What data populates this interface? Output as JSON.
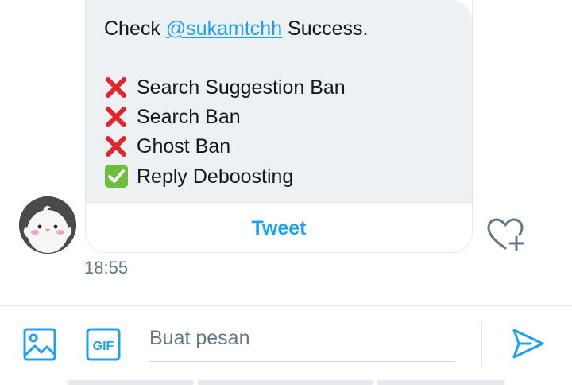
{
  "message": {
    "check_prefix": "Check",
    "mention": "@sukamtchh",
    "check_suffix": "Success.",
    "results": [
      {
        "status": "fail",
        "label": "Search Suggestion Ban"
      },
      {
        "status": "fail",
        "label": "Search Ban"
      },
      {
        "status": "fail",
        "label": "Ghost Ban"
      },
      {
        "status": "ok",
        "label": "Reply Deboosting"
      }
    ],
    "tweet_button": "Tweet",
    "time": "18:55"
  },
  "composer": {
    "placeholder": "Buat pesan",
    "gif_label": "GIF"
  },
  "colors": {
    "accent": "#1da1f2",
    "fail": "#e0262e",
    "ok": "#6cbf3a",
    "bubble_bg": "#eef1f4"
  },
  "icons": [
    "cross-mark-icon",
    "check-mark-icon",
    "image-icon",
    "gif-icon",
    "send-icon",
    "heart-plus-icon"
  ]
}
